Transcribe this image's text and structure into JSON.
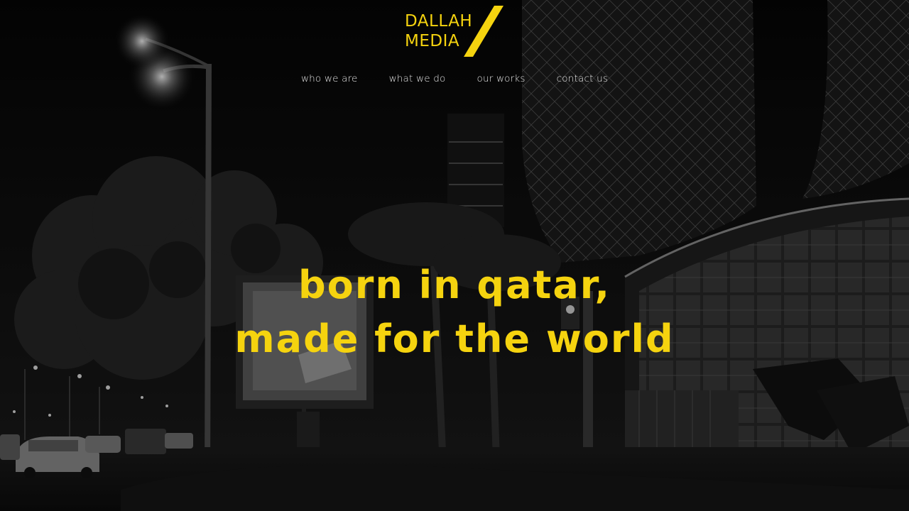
{
  "brand": {
    "logo_line1": "DALLAH",
    "logo_line2": "MEDIA",
    "accent_color": "#f5d30f"
  },
  "nav": {
    "items": [
      {
        "label": "who we are"
      },
      {
        "label": "what we do"
      },
      {
        "label": "our works"
      },
      {
        "label": "contact us"
      }
    ]
  },
  "hero": {
    "headline_line1": "born in qatar,",
    "headline_line2": "made for the world",
    "headline_color": "#f5d30f",
    "background": "night city street photograph (grayscale)"
  }
}
